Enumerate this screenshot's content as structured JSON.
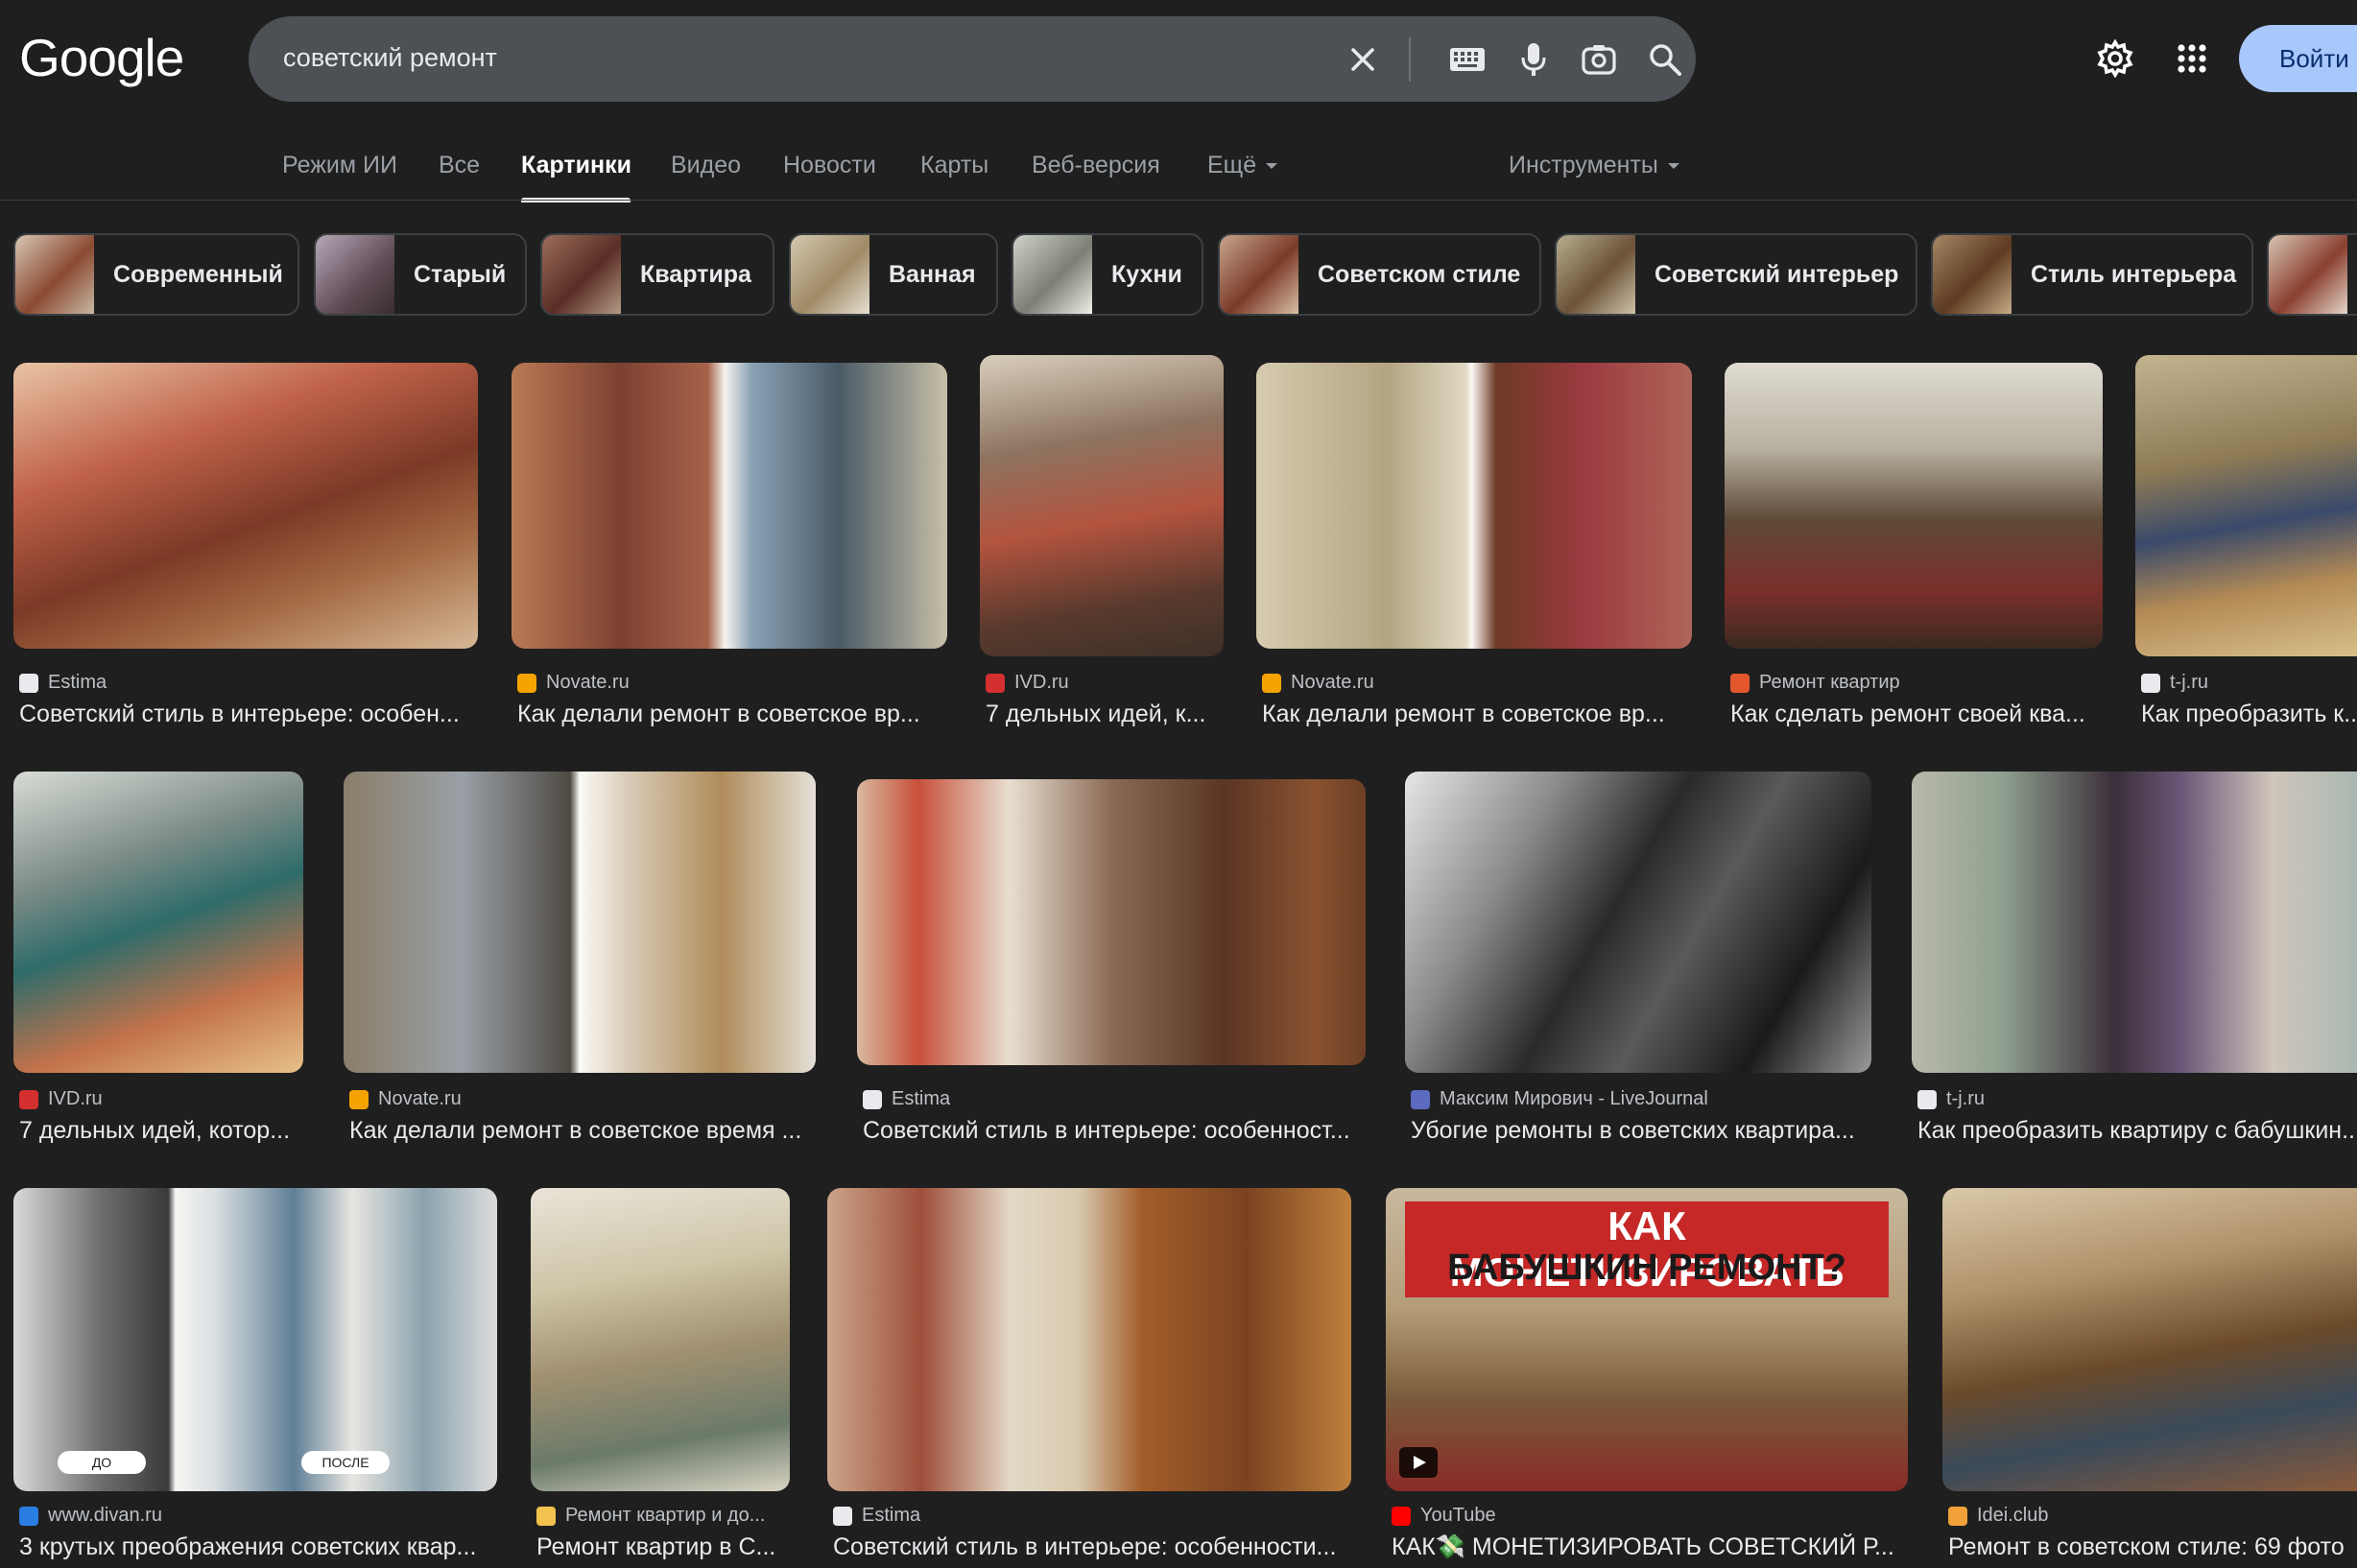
{
  "header": {
    "logo": "Google",
    "query": "советский ремонт",
    "signin_label": "Войти"
  },
  "tabs": [
    {
      "label": "Режим ИИ",
      "active": false
    },
    {
      "label": "Все",
      "active": false
    },
    {
      "label": "Картинки",
      "active": true
    },
    {
      "label": "Видео",
      "active": false
    },
    {
      "label": "Новости",
      "active": false
    },
    {
      "label": "Карты",
      "active": false
    },
    {
      "label": "Веб-версия",
      "active": false
    },
    {
      "label": "Ещё",
      "active": false
    }
  ],
  "tools_label": "Инструменты",
  "chips": [
    {
      "label": "Современный"
    },
    {
      "label": "Старый"
    },
    {
      "label": "Квартира"
    },
    {
      "label": "Ванная"
    },
    {
      "label": "Кухни"
    },
    {
      "label": "Советском стиле"
    },
    {
      "label": "Советский интерьер"
    },
    {
      "label": "Стиль интерьера"
    }
  ],
  "results": [
    {
      "source": "Estima",
      "title": "Советский стиль в интерьере: особен..."
    },
    {
      "source": "Novate.ru",
      "title": "Как делали ремонт в советское вр..."
    },
    {
      "source": "IVD.ru",
      "title": "7 дельных идей, к..."
    },
    {
      "source": "Novate.ru",
      "title": "Как делали ремонт в советское вр..."
    },
    {
      "source": "Ремонт квартир",
      "title": "Как сделать ремонт своей ква..."
    },
    {
      "source": "t-j.ru",
      "title": "Как преобразить к..."
    },
    {
      "source": "IVD.ru",
      "title": "7 дельных идей, котор..."
    },
    {
      "source": "Novate.ru",
      "title": "Как делали ремонт в советское время ..."
    },
    {
      "source": "Estima",
      "title": "Советский стиль в интерьере: особенност..."
    },
    {
      "source": "Максим Мирович - LiveJournal",
      "title": "Убогие ремонты в советских квартира..."
    },
    {
      "source": "t-j.ru",
      "title": "Как преобразить квартиру с бабушкин..."
    },
    {
      "source": "www.divan.ru",
      "title": "3 крутых преображения советских квар..."
    },
    {
      "source": "Ремонт квартир и до...",
      "title": "Ремонт квартир в С..."
    },
    {
      "source": "Estima",
      "title": "Советский стиль в интерьере: особенности..."
    },
    {
      "source": "YouTube",
      "title": "КАК💸 МОНЕТИЗИРОВАТЬ СОВЕТСКИЙ Р..."
    },
    {
      "source": "Idei.club",
      "title": "Ремонт в советском стиле: 69 фото"
    }
  ],
  "overlays": {
    "video_headline_1": "КАК МОНЕТИЗИРОВАТЬ",
    "video_headline_2": "БАБУШКИН РЕМОНТ?",
    "before_label": "ДО",
    "after_label": "ПОСЛЕ"
  },
  "colors": {
    "background": "#1f1f1f",
    "searchbox": "#4d5156",
    "signin_button": "#a8c7fa",
    "text_primary": "#e8eaed",
    "text_secondary": "#9aa0a6"
  }
}
